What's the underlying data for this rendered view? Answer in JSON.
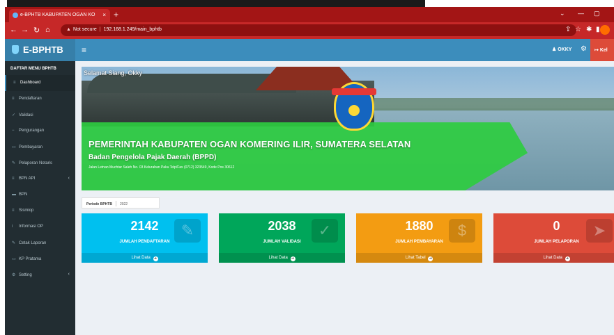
{
  "browser": {
    "tab_title": "e-BPHTB KABUPATEN OGAN KO",
    "tab_close": "×",
    "new_tab": "+",
    "not_secure": "Not secure",
    "url": "192.168.1.249/main_bphtb",
    "win_min": "—",
    "win_max": "▢",
    "win_chevron": "⌄"
  },
  "header": {
    "app_name": "E-BPHTB",
    "menu_toggle": "≡",
    "user": "OKKY",
    "logout": "Kel"
  },
  "sidebar": {
    "title": "DAFTAR MENU BPHTB",
    "items": [
      {
        "label": "Dashboard",
        "icon": "≡",
        "active": true
      },
      {
        "label": "Pendaftaran",
        "icon": "≡"
      },
      {
        "label": "Validasi",
        "icon": "✓"
      },
      {
        "label": "Pengurangan",
        "icon": "−"
      },
      {
        "label": "Pembayaran",
        "icon": "▭"
      },
      {
        "label": "Pelaporan Notaris",
        "icon": "✎"
      },
      {
        "label": "BPN API",
        "icon": "≡",
        "caret": "‹"
      },
      {
        "label": "BPN",
        "icon": "▬"
      },
      {
        "label": "Sismiop",
        "icon": "≡"
      },
      {
        "label": "Informasi OP",
        "icon": "i"
      },
      {
        "label": "Cetak Laporan",
        "icon": "✎"
      },
      {
        "label": "KP Pratama",
        "icon": "▭"
      },
      {
        "label": "Setting",
        "icon": "⚙",
        "caret": "‹"
      }
    ]
  },
  "banner": {
    "greeting": "Selamat Siang, Okky",
    "title": "PEMERINTAH KABUPATEN OGAN KOMERING ILIR, SUMATERA SELATAN",
    "subtitle": "Badan Pengelola Pajak Daerah (BPPD)",
    "address": "Jalan Letnan Muchtar Saleh No. 03 Kelurahan Paku Telp/Fax (0712) 323549, Kode Pos 30612"
  },
  "period": {
    "label": "Periode BPHTB",
    "value": "2022"
  },
  "stats": [
    {
      "value": "2142",
      "label": "JUMLAH PENDAFTARAN",
      "link": "Lihat Data",
      "color": "#00c0ef",
      "icon": "pencil-icon",
      "glyph": "✎"
    },
    {
      "value": "2038",
      "label": "JUMLAH VALIDASI",
      "link": "Lihat Data",
      "color": "#00a65a",
      "icon": "check-icon",
      "glyph": "✓"
    },
    {
      "value": "1880",
      "label": "JUMLAH PEMBAYARAN",
      "link": "Lihat Tabel",
      "color": "#f39c12",
      "icon": "money-icon",
      "glyph": "$"
    },
    {
      "value": "0",
      "label": "JUMLAH PELAPORAN",
      "link": "Lihat Data",
      "color": "#dd4b39",
      "icon": "send-icon",
      "glyph": "➤"
    }
  ]
}
